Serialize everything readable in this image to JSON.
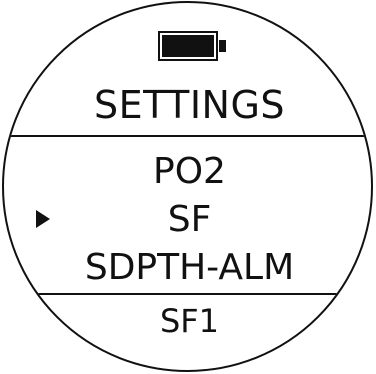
{
  "screen": {
    "title": "SETTINGS",
    "battery_icon": "battery-full-icon",
    "menu_items": [
      {
        "label": "PO2",
        "selected": false
      },
      {
        "label": "SF",
        "selected": true
      },
      {
        "label": "SDPTH-ALM",
        "selected": false
      }
    ],
    "selector_icon": "triangle-right-icon",
    "current_value": "SF1"
  },
  "colors": {
    "foreground": "#111111",
    "background": "#ffffff"
  }
}
